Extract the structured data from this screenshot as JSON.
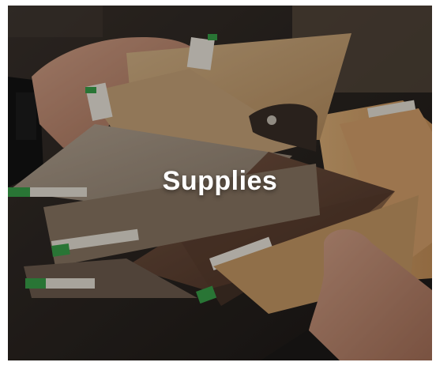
{
  "card": {
    "title": "Supplies",
    "image_icon": "wood-flooring-samples-photo",
    "colors": {
      "title_text": "#ffffff",
      "sample_tag": "#3aa34a"
    }
  }
}
